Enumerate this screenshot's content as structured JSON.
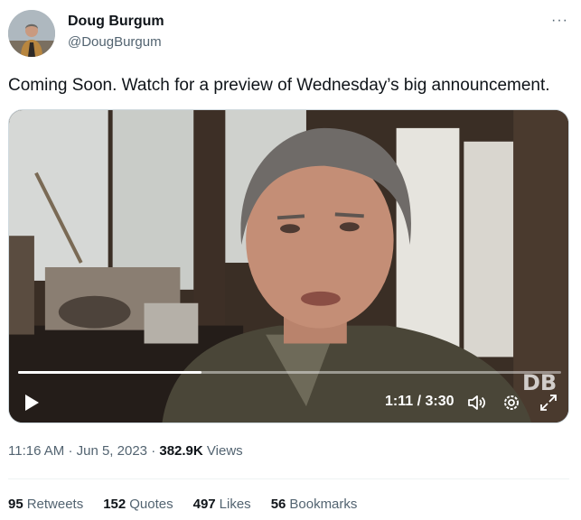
{
  "author": {
    "name": "Doug Burgum",
    "handle": "@DougBurgum"
  },
  "more_icon": "more-horizontal-icon",
  "tweet": {
    "text": "Coming Soon. Watch for a preview of Wednesday’s big announcement."
  },
  "video": {
    "time_display": "1:11 / 3:30",
    "progress": 0.338,
    "watermark": "DB",
    "icons": [
      "play-icon",
      "volume-icon",
      "settings-icon",
      "fullscreen-icon"
    ]
  },
  "meta": {
    "time": "11:16 AM",
    "separator1": "·",
    "date": "Jun 5, 2023",
    "separator2": "·",
    "views_count": "382.9K",
    "views_label": "Views"
  },
  "stats": [
    {
      "count": "95",
      "label": "Retweets"
    },
    {
      "count": "152",
      "label": "Quotes"
    },
    {
      "count": "497",
      "label": "Likes"
    },
    {
      "count": "56",
      "label": "Bookmarks"
    }
  ],
  "colors": {
    "text_primary": "#0f1419",
    "text_secondary": "#536471",
    "divider": "#eff3f4"
  }
}
